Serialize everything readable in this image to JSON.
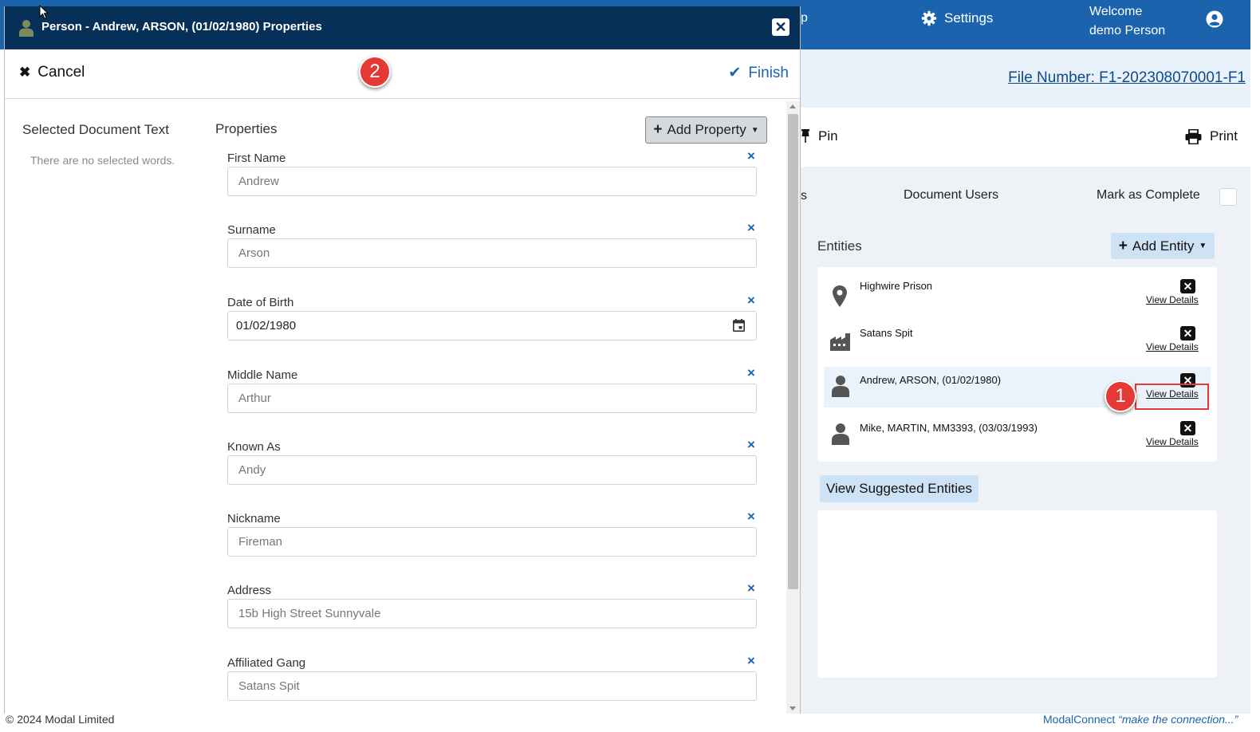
{
  "app": {
    "help_fragment": "p",
    "settings_label": "Settings",
    "welcome_line1": "Welcome",
    "welcome_line2": "demo Person",
    "file_number": "File Number: F1-202308070001-F1",
    "pin_label": "Pin",
    "print_label": "Print",
    "tab_fragment": "s",
    "document_users_label": "Document Users",
    "mark_complete_label": "Mark as Complete",
    "entities_label": "Entities",
    "add_entity_label": "Add Entity",
    "entities": [
      {
        "name": "Highwire Prison",
        "icon": "map-marker-icon",
        "view": "View Details"
      },
      {
        "name": "Satans Spit",
        "icon": "factory-icon",
        "view": "View Details"
      },
      {
        "name": "Andrew, ARSON, (01/02/1980)",
        "icon": "person-icon",
        "view": "View Details"
      },
      {
        "name": "Mike, MARTIN, MM3393, (03/03/1993)",
        "icon": "person-icon",
        "view": "View Details"
      }
    ],
    "view_suggested_label": "View Suggested Entities",
    "footer_left": "© 2024 Modal Limited",
    "footer_right_brand": "ModalConnect ",
    "footer_right_tagline": "“make the connection...”"
  },
  "annotations": {
    "badge_1": "1",
    "badge_2": "2",
    "accent_color": "#e53935"
  },
  "modal": {
    "title": "Person - Andrew, ARSON, (01/02/1980) Properties",
    "cancel_label": "Cancel",
    "finish_label": "Finish",
    "selected_text_title": "Selected Document Text",
    "selected_text_empty": "There are no selected words.",
    "properties_label": "Properties",
    "add_property_label": "Add Property",
    "properties": [
      {
        "label": "First Name",
        "value": "Andrew"
      },
      {
        "label": "Surname",
        "value": "Arson"
      },
      {
        "label": "Date of Birth",
        "value": "01/02/1980"
      },
      {
        "label": "Middle Name",
        "value": "Arthur"
      },
      {
        "label": "Known As",
        "value": "Andy"
      },
      {
        "label": "Nickname",
        "value": "Fireman"
      },
      {
        "label": "Address",
        "value": "15b High Street Sunnyvale"
      },
      {
        "label": "Affiliated Gang",
        "value": "Satans Spit"
      }
    ]
  },
  "colors": {
    "header_blue": "#1b63ad",
    "modal_title_navy": "#063058",
    "link_blue": "#0d4a8c"
  }
}
